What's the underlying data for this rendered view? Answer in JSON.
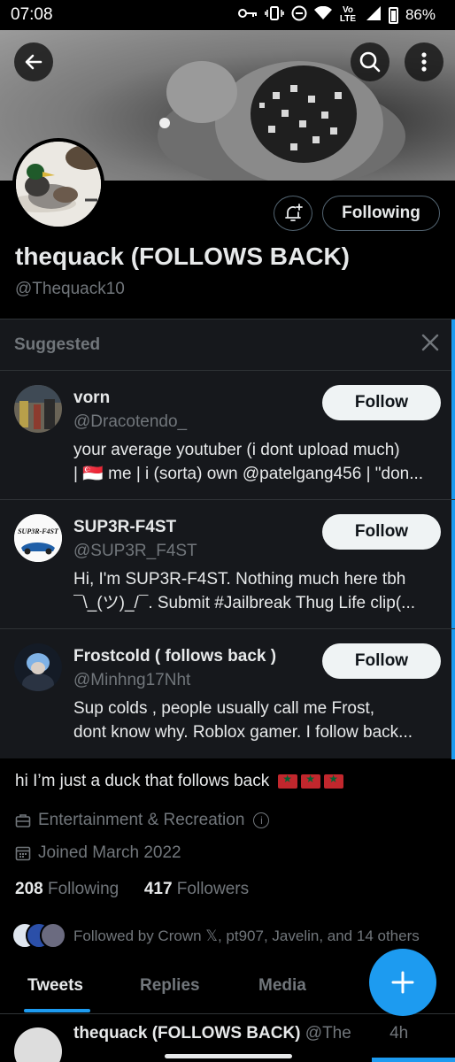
{
  "status_bar": {
    "time": "07:08",
    "battery": "86%",
    "icons": [
      "key-icon",
      "vibrate-icon",
      "dnd-icon",
      "wifi-icon",
      "volte-icon",
      "signal-icon",
      "battery-icon"
    ],
    "volte_label": "Vo LTE"
  },
  "header": {
    "back_icon": "arrow-left-icon",
    "search_icon": "search-icon",
    "more_icon": "more-vertical-icon"
  },
  "profile": {
    "display_name": "thequack (FOLLOWS BACK)",
    "handle": "@Thequack10",
    "following_button": "Following",
    "bio_text": "hi I’m just a duck that follows back",
    "category": "Entertainment & Recreation",
    "joined": "Joined March 2022",
    "following_count": "208",
    "following_label": "Following",
    "followers_count": "417",
    "followers_label": "Followers",
    "followed_by": "Followed by Crown 𝕏, pt907, Javelin, and 14 others"
  },
  "suggested": {
    "title": "Suggested",
    "items": [
      {
        "name": "vorn",
        "handle": "@Dracotendo_",
        "bio_line1": "your average youtuber (i dont upload much)",
        "bio_line2": "| 🇸🇬 me | i (sorta) own @patelgang456 | \"don...",
        "button": "Follow"
      },
      {
        "name": "SUP3R-F4ST",
        "handle": "@SUP3R_F4ST",
        "avatar_text": "SUP3R-F4ST",
        "bio_line1": "Hi, I'm SUP3R-F4ST. Nothing much here tbh",
        "bio_line2": "¯\\_(ツ)_/¯. Submit #Jailbreak Thug Life clip(...",
        "button": "Follow"
      },
      {
        "name": "Frostcold ( follows back )",
        "handle": "@Minhng17Nht",
        "bio_line1": "Sup colds , people usually call me Frost,",
        "bio_line2": "dont know why. Roblox gamer. I follow back...",
        "button": "Follow"
      }
    ]
  },
  "tabs": [
    "Tweets",
    "Replies",
    "Media"
  ],
  "tweet_peek": {
    "name": "thequack (FOLLOWS BACK)",
    "handle": "@The",
    "time": "4h"
  },
  "colors": {
    "accent": "#1d9bf0",
    "background": "#000000",
    "panel": "#16181c",
    "secondary_text": "#71767b"
  }
}
